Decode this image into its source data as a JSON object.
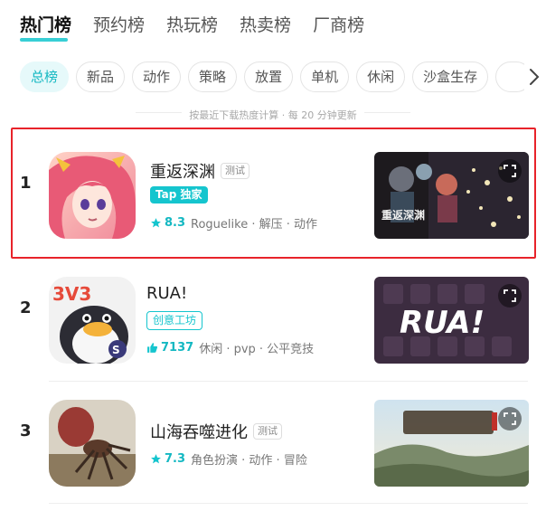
{
  "top_tabs": [
    {
      "label": "热门榜"
    },
    {
      "label": "预约榜"
    },
    {
      "label": "热玩榜"
    },
    {
      "label": "热卖榜"
    },
    {
      "label": "厂商榜"
    }
  ],
  "chips": [
    {
      "label": "总榜"
    },
    {
      "label": "新品"
    },
    {
      "label": "动作"
    },
    {
      "label": "策略"
    },
    {
      "label": "放置"
    },
    {
      "label": "单机"
    },
    {
      "label": "休闲"
    },
    {
      "label": "沙盒生存"
    },
    {
      "label": ""
    }
  ],
  "sort_note": "按最近下载热度计算 · 每 20 分钟更新",
  "games": [
    {
      "rank": "1",
      "title": "重返深渊",
      "test_badge": "测试",
      "tag": "Tap 独家",
      "score": "8.3",
      "genres": "Roguelike · 解压 · 动作",
      "icon": "anime-girl-icon",
      "thumb": "dark-battle-screenshot"
    },
    {
      "rank": "2",
      "title": "RUA!",
      "tag": "创意工坊",
      "score": "7137",
      "genres": "休闲 · pvp · 公平竞技",
      "icon": "penguin-3v3-icon",
      "thumb": "rua-logo-screenshot",
      "thumb_text": "RUA!"
    },
    {
      "rank": "3",
      "title": "山海吞噬进化",
      "test_badge": "测试",
      "score": "7.3",
      "genres": "角色扮演 · 动作 · 冒险",
      "icon": "spider-monster-icon",
      "thumb": "landscape-screenshot"
    }
  ],
  "colors": {
    "accent": "#15c5ce",
    "highlight": "#e8232a"
  }
}
